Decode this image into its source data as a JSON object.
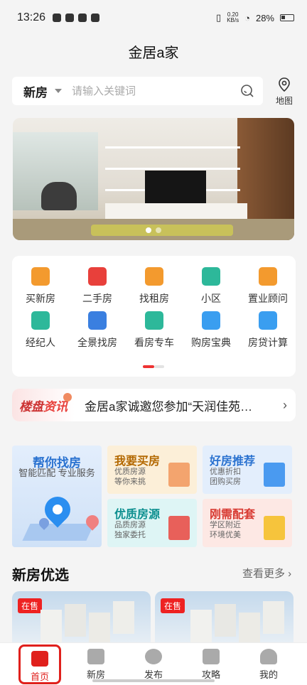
{
  "status": {
    "time": "13:26",
    "net_speed": "0.20",
    "net_unit": "KB/s",
    "battery": "28%"
  },
  "app": {
    "title": "金居a家"
  },
  "search": {
    "city": "新房",
    "placeholder": "请输入关键词",
    "map_label": "地图"
  },
  "quick": [
    {
      "label": "买新房",
      "color": "#f39a2e"
    },
    {
      "label": "二手房",
      "color": "#e8403b"
    },
    {
      "label": "找租房",
      "color": "#f39a2e"
    },
    {
      "label": "小区",
      "color": "#2db89a"
    },
    {
      "label": "置业顾问",
      "color": "#f39a2e"
    },
    {
      "label": "经纪人",
      "color": "#2db89a"
    },
    {
      "label": "全景找房",
      "color": "#3a7fe0"
    },
    {
      "label": "看房专车",
      "color": "#2db89a"
    },
    {
      "label": "购房宝典",
      "color": "#3a9ef0"
    },
    {
      "label": "房贷计算",
      "color": "#3a9ef0"
    }
  ],
  "news": {
    "tag_a": "楼盘",
    "tag_b": "资讯",
    "text": "金居a家诚邀您参加“天润佳苑…"
  },
  "promo": {
    "big": {
      "title": "帮你找房",
      "sub": "智能匹配 专业服务"
    },
    "c1": {
      "title": "我要买房",
      "sub1": "优质房源",
      "sub2": "等你来挑"
    },
    "c2": {
      "title": "好房推荐",
      "sub1": "优惠折扣",
      "sub2": "团购买房"
    },
    "c3": {
      "title": "优质房源",
      "sub1": "品质房源",
      "sub2": "独家委托"
    },
    "c4": {
      "title": "刚需配套",
      "sub1": "学区附近",
      "sub2": "环境优美"
    }
  },
  "section": {
    "title": "新房优选",
    "more": "查看更多 ›"
  },
  "listings": [
    {
      "badge": "在售"
    },
    {
      "badge": "在售"
    }
  ],
  "tabs": [
    {
      "label": "首页"
    },
    {
      "label": "新房"
    },
    {
      "label": "发布"
    },
    {
      "label": "攻略"
    },
    {
      "label": "我的"
    }
  ]
}
